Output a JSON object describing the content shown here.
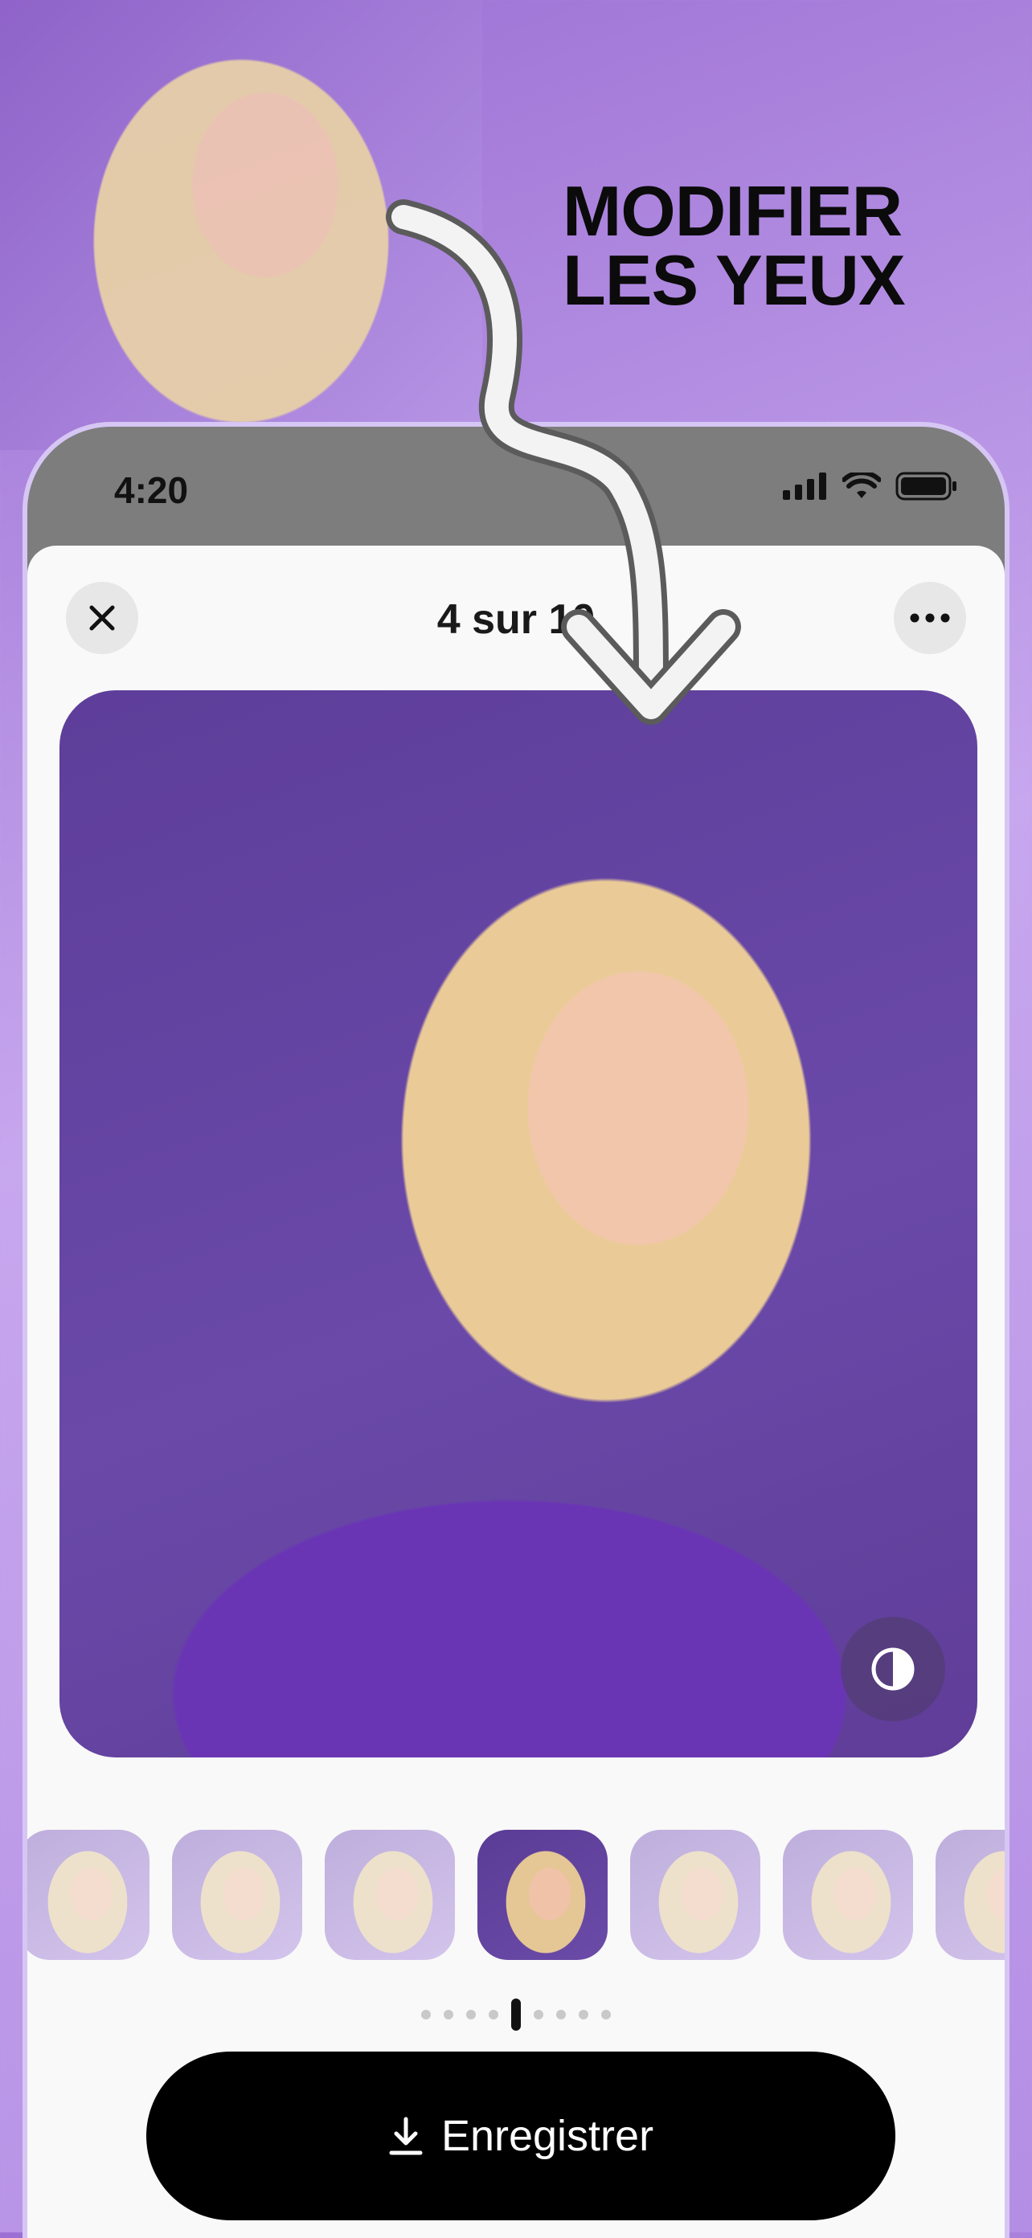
{
  "headline": {
    "line1": "MODIFIER",
    "line2": "LES YEUX"
  },
  "status_bar": {
    "time": "4:20"
  },
  "viewer": {
    "counter": "4 sur 10"
  },
  "thumbnails": {
    "count": 7,
    "active_index": 3
  },
  "pager": {
    "dots": 9,
    "active_index": 4
  },
  "save_button": {
    "label": "Enregistrer"
  },
  "colors": {
    "accent": "#6a49a9",
    "background": "#b894e6",
    "button": "#000000"
  },
  "icons": [
    "close-icon",
    "more-icon",
    "compare-icon",
    "download-icon",
    "signal-icon",
    "wifi-icon",
    "battery-icon"
  ]
}
